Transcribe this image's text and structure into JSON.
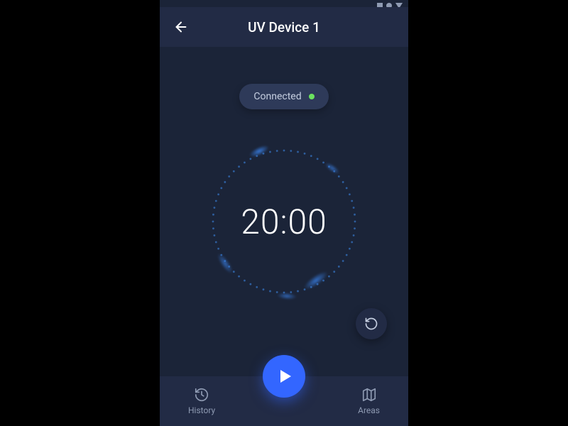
{
  "header": {
    "title": "UV Device 1"
  },
  "status": {
    "label": "Connected",
    "dot_color": "#6be35f"
  },
  "timer": {
    "display": "20:00"
  },
  "nav": {
    "history": {
      "label": "History"
    },
    "areas": {
      "label": "Areas"
    }
  },
  "colors": {
    "accent": "#3366ff",
    "bg": "#1b2438",
    "surface": "#222b45"
  }
}
